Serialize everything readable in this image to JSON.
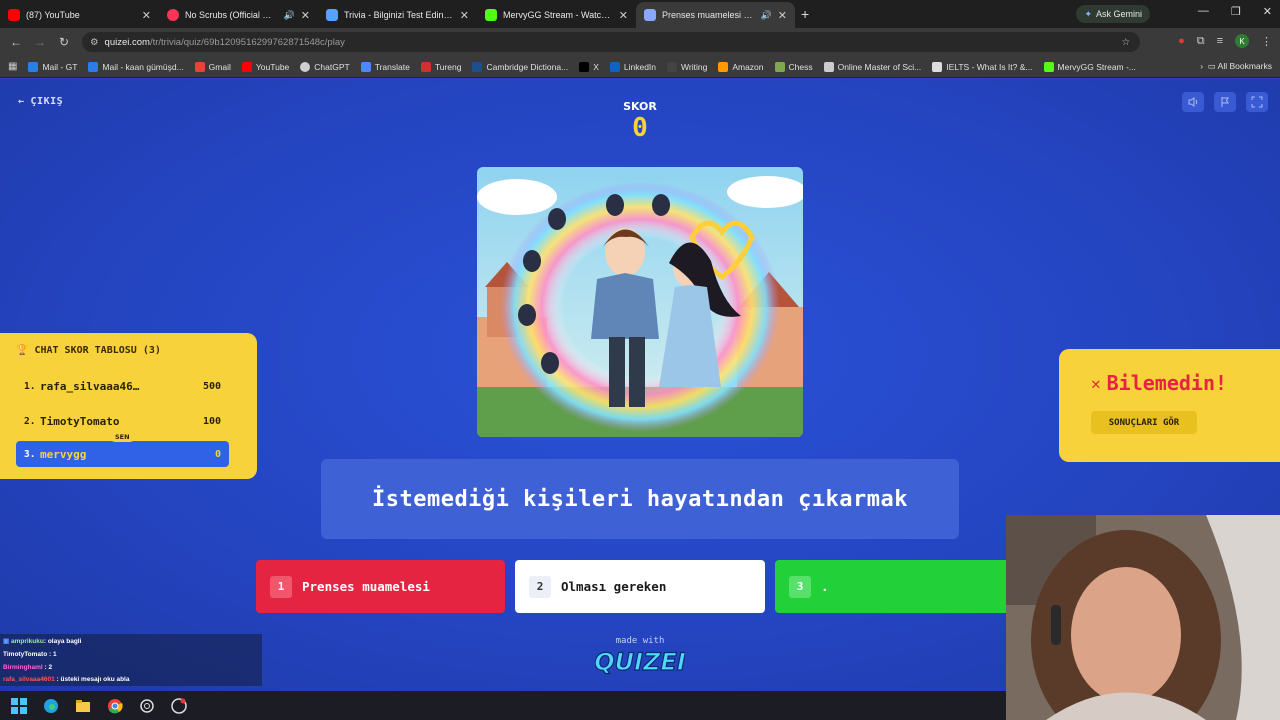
{
  "browser": {
    "tabs": [
      {
        "title": "(87) YouTube",
        "color": "#ff0000",
        "audio": false
      },
      {
        "title": "No Scrubs (Official HD Vide",
        "color": "#ff3355",
        "audio": true
      },
      {
        "title": "Trivia - Bilginizi Test Edin - Qui",
        "color": "#5aa0ff",
        "audio": false
      },
      {
        "title": "MervyGG Stream - Watch Live c",
        "color": "#53fc18",
        "audio": false
      },
      {
        "title": "Prenses muamelesi mi olm",
        "color": "#8aa8ff",
        "audio": true
      }
    ],
    "gemini_label": "Ask Gemini",
    "url_host": "quizei.com",
    "url_path": "/tr/trivia/quiz/69b1209516299762871548c/play",
    "bookmarks": [
      {
        "label": "Mail - GT",
        "color": "#2b7de9"
      },
      {
        "label": "Mail - kaan gümüşd...",
        "color": "#2b7de9"
      },
      {
        "label": "Gmail",
        "color": "#ea4335"
      },
      {
        "label": "YouTube",
        "color": "#ff0000"
      },
      {
        "label": "ChatGPT",
        "color": "#cfcfcf"
      },
      {
        "label": "Translate",
        "color": "#4a8af4"
      },
      {
        "label": "Tureng",
        "color": "#d32f2f"
      },
      {
        "label": "Cambridge Dictiona...",
        "color": "#1f4e8c"
      },
      {
        "label": "X",
        "color": "#000000"
      },
      {
        "label": "LinkedIn",
        "color": "#0a66c2"
      },
      {
        "label": "Writing",
        "color": "#444444"
      },
      {
        "label": "Amazon",
        "color": "#ff9900"
      },
      {
        "label": "Chess",
        "color": "#7fa650"
      },
      {
        "label": "Online Master of Sci...",
        "color": "#cccccc"
      },
      {
        "label": "IELTS - What Is It? &...",
        "color": "#dddddd"
      },
      {
        "label": "MervyGG Stream -...",
        "color": "#53fc18"
      }
    ],
    "all_bookmarks": "All Bookmarks",
    "profile_initial": "K"
  },
  "game": {
    "exit_label": "ÇIKIŞ",
    "score_label": "SKOR",
    "score_value": "0",
    "question": "İstemediği kişileri hayatından çıkarmak",
    "answers": [
      {
        "num": "1",
        "text": "Prenses muamelesi"
      },
      {
        "num": "2",
        "text": "Olması gereken"
      },
      {
        "num": "3",
        "text": "."
      }
    ],
    "made_with": "made with",
    "logo_text": "QUIZEI"
  },
  "leaderboard": {
    "title": "CHAT SKOR TABLOSU (3)",
    "you_badge": "SEN",
    "rows": [
      {
        "rank": "1.",
        "name": "rafa_silvaaa46…",
        "score": "500"
      },
      {
        "rank": "2.",
        "name": "TimotyTomato",
        "score": "100"
      },
      {
        "rank": "3.",
        "name": "mervygg",
        "score": "0"
      }
    ]
  },
  "result": {
    "title": "Bilemedin!",
    "button": "SONUÇLARI GÖR"
  },
  "chat": [
    {
      "user": "amprikuku",
      "msg": ": olaya bagli",
      "color": "#9ef08a"
    },
    {
      "user": "TimotyTomato",
      "msg": ": 1",
      "color": "#ffffff"
    },
    {
      "user": "Birminghaml",
      "msg": ": 2",
      "color": "#ff66cc"
    },
    {
      "user": "rafa_silvaaa4601",
      "msg": ": üsteki mesajı oku abla",
      "color": "#ff5555"
    }
  ]
}
